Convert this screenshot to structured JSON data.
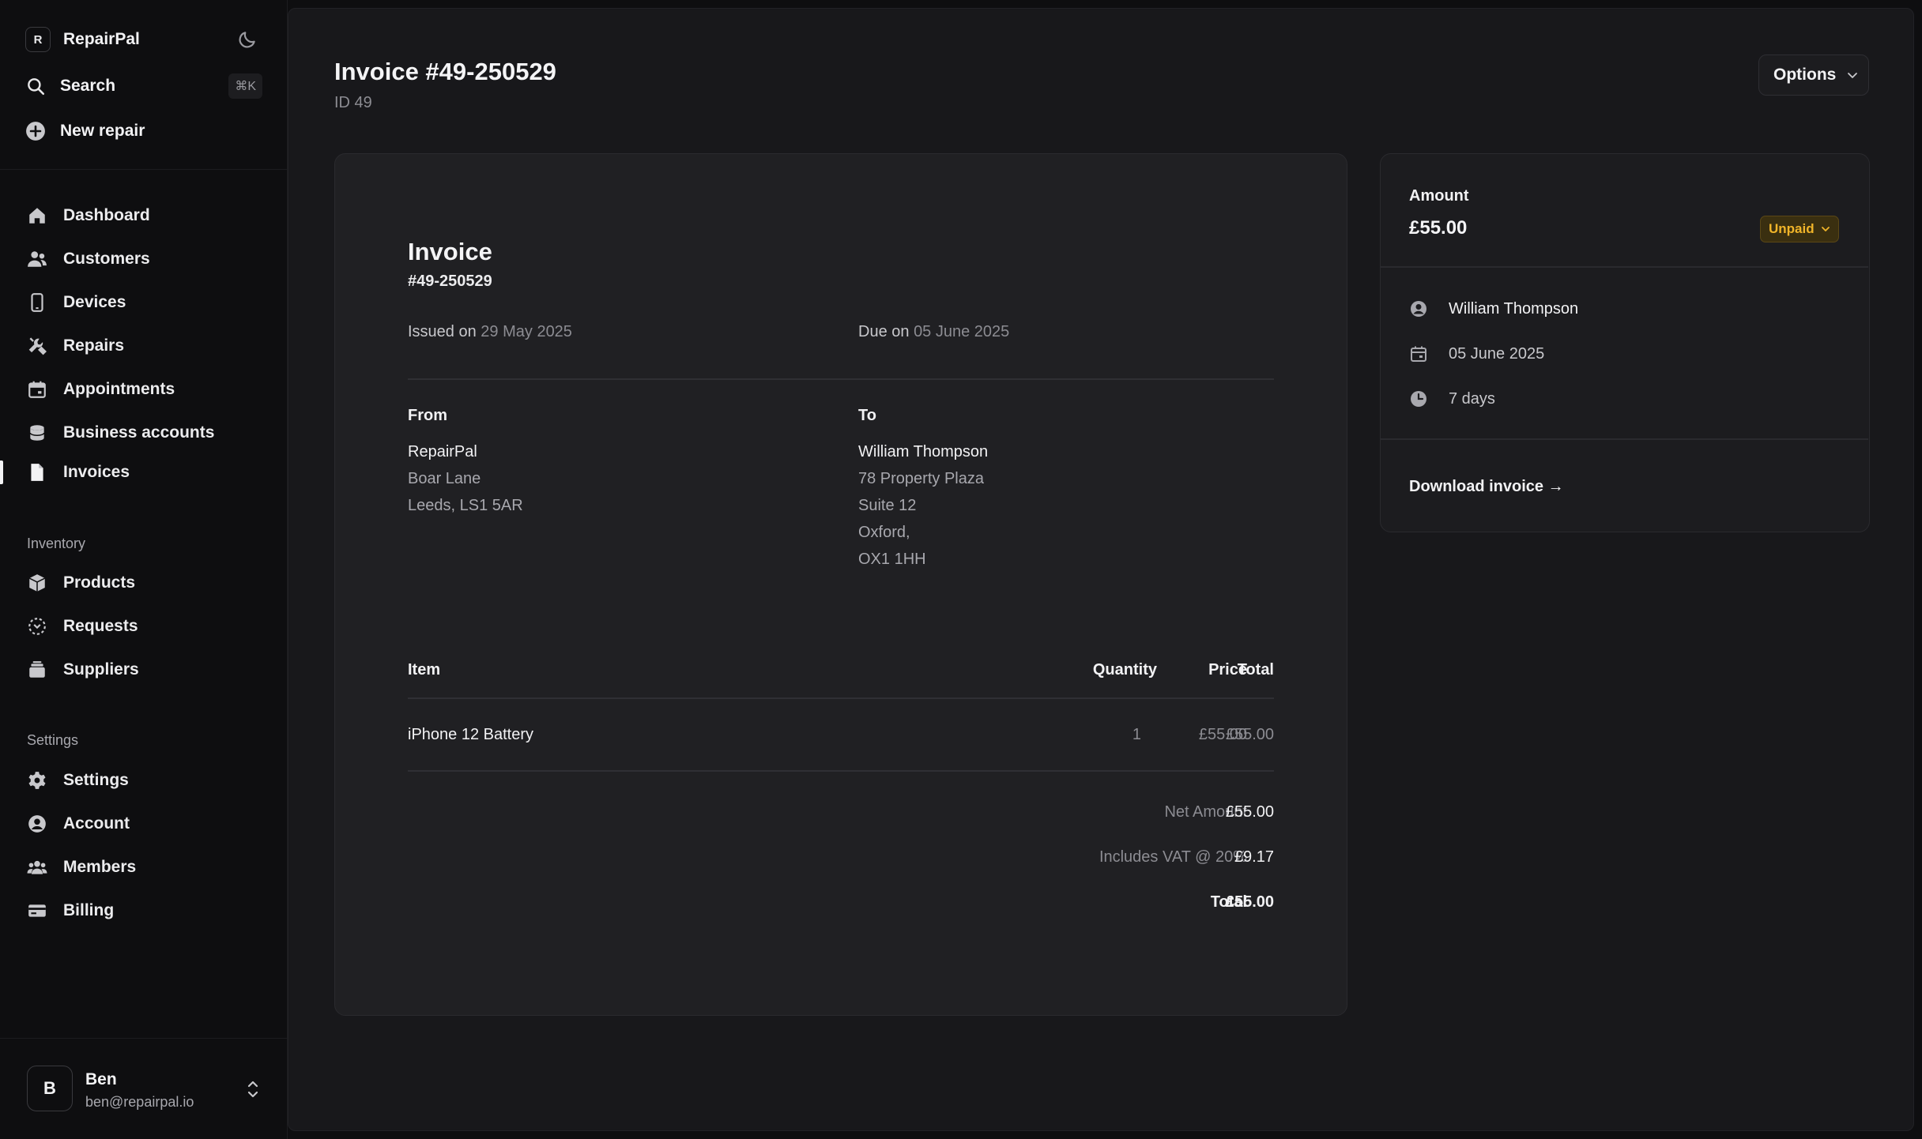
{
  "app": {
    "logo_letter": "R",
    "name": "RepairPal"
  },
  "search": {
    "label": "Search",
    "shortcut": "⌘K"
  },
  "new_repair": {
    "label": "New repair"
  },
  "nav": {
    "main": [
      {
        "label": "Dashboard",
        "icon": "home-icon"
      },
      {
        "label": "Customers",
        "icon": "users-icon"
      },
      {
        "label": "Devices",
        "icon": "device-icon"
      },
      {
        "label": "Repairs",
        "icon": "tools-icon"
      },
      {
        "label": "Appointments",
        "icon": "calendar-icon"
      },
      {
        "label": "Business accounts",
        "icon": "database-icon"
      },
      {
        "label": "Invoices",
        "icon": "document-icon",
        "active": true
      }
    ],
    "inventory_label": "Inventory",
    "inventory": [
      {
        "label": "Products",
        "icon": "box-icon"
      },
      {
        "label": "Requests",
        "icon": "request-icon"
      },
      {
        "label": "Suppliers",
        "icon": "supplier-icon"
      }
    ],
    "settings_label": "Settings",
    "settings": [
      {
        "label": "Settings",
        "icon": "gear-icon"
      },
      {
        "label": "Account",
        "icon": "user-circle-icon"
      },
      {
        "label": "Members",
        "icon": "members-icon"
      },
      {
        "label": "Billing",
        "icon": "card-icon"
      }
    ]
  },
  "user": {
    "initial": "B",
    "name": "Ben",
    "email": "ben@repairpal.io"
  },
  "header": {
    "title": "Invoice #49-250529",
    "subtitle": "ID 49",
    "options_label": "Options"
  },
  "invoice": {
    "title": "Invoice",
    "number": "#49-250529",
    "issued_label": "Issued on",
    "issued_value": "29 May 2025",
    "due_label": "Due on",
    "due_value": "05 June 2025",
    "from": {
      "heading": "From",
      "name": "RepairPal",
      "lines": [
        "Boar Lane",
        "Leeds, LS1 5AR"
      ]
    },
    "to": {
      "heading": "To",
      "name": "William Thompson",
      "lines": [
        "78 Property Plaza",
        "Suite 12",
        "Oxford,",
        "OX1 1HH"
      ]
    },
    "columns": {
      "item": "Item",
      "quantity": "Quantity",
      "price": "Price",
      "total": "Total"
    },
    "rows": [
      {
        "item": "iPhone 12 Battery",
        "quantity": "1",
        "price": "£55.00",
        "total": "£55.00"
      }
    ],
    "net_label": "Net Amount",
    "net_value": "£55.00",
    "vat_label": "Includes VAT @ 20%",
    "vat_value": "£9.17",
    "total_label": "Total",
    "total_value": "£55.00"
  },
  "summary": {
    "amount_label": "Amount",
    "amount_value": "£55.00",
    "status": "Unpaid",
    "status_color": "#f0b429",
    "customer": "William Thompson",
    "due_date": "05 June 2025",
    "term": "7 days",
    "download_label": "Download invoice →"
  }
}
